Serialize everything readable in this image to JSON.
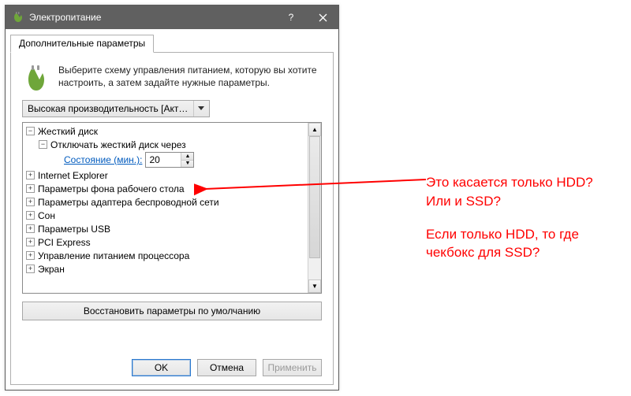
{
  "title": "Электропитание",
  "tab_label": "Дополнительные параметры",
  "intro": "Выберите схему управления питанием, которую вы хотите настроить, а затем задайте нужные параметры.",
  "plan_selected": "Высокая производительность [Активен",
  "tree": {
    "hard_disk": "Жесткий диск",
    "turn_off_after": "Отключать жесткий диск через",
    "state_label": "Состояние (мин.):",
    "state_value": "20",
    "ie": "Internet Explorer",
    "desktop_bg": "Параметры фона рабочего стола",
    "wireless": "Параметры адаптера беспроводной сети",
    "sleep": "Сон",
    "usb": "Параметры USB",
    "pci": "PCI Express",
    "cpu": "Управление питанием процессора",
    "display": "Экран"
  },
  "restore_defaults": "Восстановить параметры по умолчанию",
  "buttons": {
    "ok": "OK",
    "cancel": "Отмена",
    "apply": "Применить"
  },
  "annotation": {
    "line1": "Это касается только HDD?",
    "line2": "Или и SSD?",
    "line3": "Если только HDD, то где",
    "line4": "чекбокс для SSD?"
  }
}
